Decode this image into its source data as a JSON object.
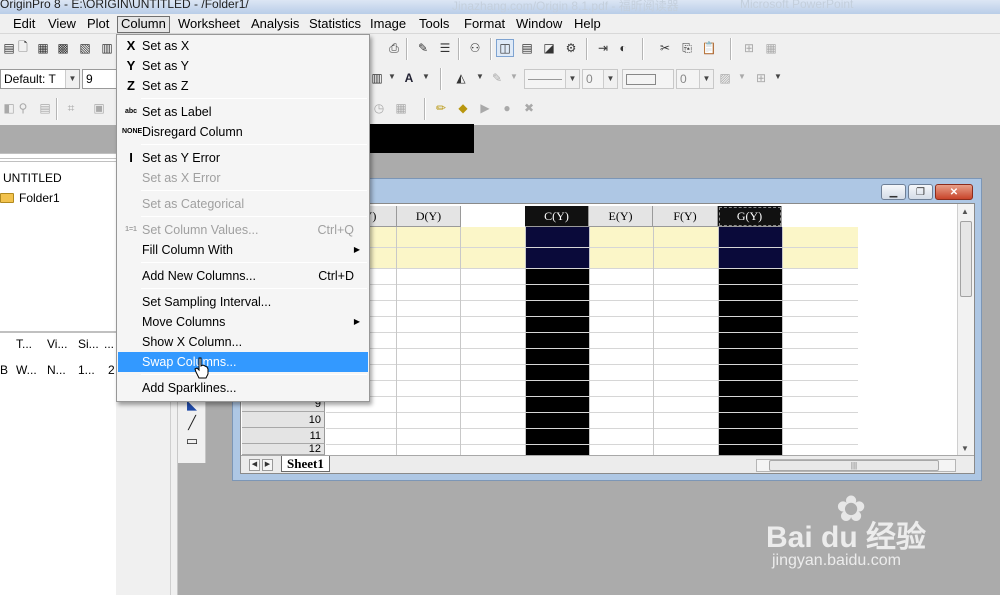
{
  "window": {
    "title": "OriginPro 8 - E:\\ORIGIN\\UNTITLED - /Folder1/",
    "title_ghost_1": "Jinazhang.com/Origin 8.1.pdf - 福昕阅读器",
    "title_ghost_2": "Microsoft PowerPoint"
  },
  "menubar": [
    "Edit",
    "View",
    "Plot",
    "Column",
    "Worksheet",
    "Analysis",
    "Statistics",
    "Image",
    "Tools",
    "Format",
    "Window",
    "Help"
  ],
  "toolbar": {
    "font_name": "Default: T",
    "font_size": "9",
    "line_width_1": "0",
    "line_width_2": "0"
  },
  "column_menu": {
    "items": [
      {
        "icon": "X",
        "label": "Set as X"
      },
      {
        "icon": "Y",
        "label": "Set as Y"
      },
      {
        "icon": "Z",
        "label": "Set as Z"
      },
      {
        "icon": "abc",
        "label": "Set as Label"
      },
      {
        "icon": "NONE",
        "label": "Disregard Column"
      },
      {
        "icon": "I",
        "label": "Set as Y Error"
      },
      {
        "icon": "",
        "label": "Set as X Error"
      },
      {
        "icon": "",
        "label": "Set as Categorical"
      },
      {
        "icon": "1=1",
        "label": "Set Column Values...",
        "shortcut": "Ctrl+Q"
      },
      {
        "icon": "",
        "label": "Fill Column With",
        "submenu": "▶"
      },
      {
        "icon": "",
        "label": "Add New Columns...",
        "shortcut": "Ctrl+D"
      },
      {
        "icon": "",
        "label": "Set Sampling Interval..."
      },
      {
        "icon": "",
        "label": "Move Columns",
        "submenu": "▶"
      },
      {
        "icon": "",
        "label": "Show X Column..."
      },
      {
        "icon": "",
        "label": "Swap Columns..."
      },
      {
        "icon": "",
        "label": "Add Sparklines..."
      }
    ]
  },
  "explorer": {
    "root": "UNTITLED",
    "folder": "Folder1",
    "list_headers": [
      "T...",
      "Vi...",
      "Si...",
      "..."
    ],
    "list_row": [
      "B",
      "W...",
      "N...",
      "1...",
      "2"
    ]
  },
  "worksheet": {
    "columns": [
      "B(Y)",
      "D(Y)",
      "C(Y)",
      "E(Y)",
      "F(Y)",
      "G(Y)"
    ],
    "row_numbers": [
      "9",
      "10",
      "11",
      "12"
    ],
    "sheet_tab": "Sheet1"
  },
  "watermark": {
    "text": "Bai du 经验",
    "url": "jingyan.baidu.com"
  }
}
